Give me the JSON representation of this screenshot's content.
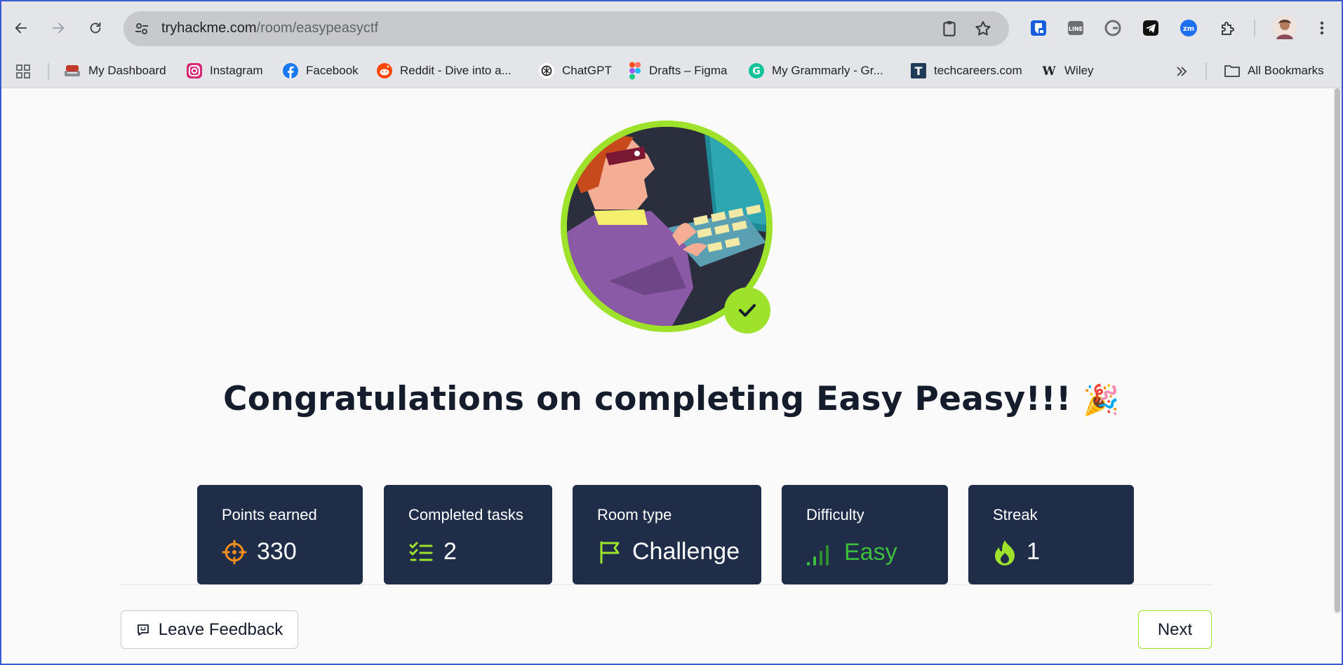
{
  "browser": {
    "url_domain": "tryhackme.com",
    "url_path": "/room/easypeasyctf"
  },
  "extensions": [
    {
      "icon": "bitwarden-icon",
      "color": "#175ddc"
    },
    {
      "icon": "line-icon",
      "color": "#6b6e72"
    },
    {
      "icon": "grammarly-icon",
      "color": "#6b6e72"
    },
    {
      "icon": "telegram-icon",
      "color": "#111111"
    },
    {
      "icon": "zoom-icon",
      "color": "#1e6ff0"
    },
    {
      "icon": "extensions-puzzle-icon",
      "color": "#3c4043"
    }
  ],
  "bookmarks": [
    {
      "label": "My Dashboard",
      "icon": "dashboard-icon",
      "color": "#8a8f96"
    },
    {
      "label": "Instagram",
      "icon": "instagram-icon",
      "color": "#d62976"
    },
    {
      "label": "Facebook",
      "icon": "facebook-icon",
      "color": "#1877f2"
    },
    {
      "label": "Reddit - Dive into a...",
      "icon": "reddit-icon",
      "color": "#ff4500"
    },
    {
      "label": "ChatGPT",
      "icon": "chatgpt-icon",
      "color": "#ffffff"
    },
    {
      "label": "Drafts – Figma",
      "icon": "figma-icon",
      "color": "#a259ff"
    },
    {
      "label": "My Grammarly - Gr...",
      "icon": "grammarly-icon",
      "color": "#15c39a"
    },
    {
      "label": "techcareers.com",
      "icon": "techcareers-icon",
      "color": "#1f3b57"
    },
    {
      "label": "Wiley",
      "icon": "wiley-icon",
      "color": "#ffffff"
    }
  ],
  "bookmarks_all": "All Bookmarks",
  "page": {
    "title": "Congratulations on completing Easy Peasy!!!",
    "title_emoji": "🎉",
    "stats": [
      {
        "label": "Points earned",
        "value": "330",
        "icon": "target-icon",
        "color": "#f5901e"
      },
      {
        "label": "Completed tasks",
        "value": "2",
        "icon": "checklist-icon",
        "color": "#9ee22b"
      },
      {
        "label": "Room type",
        "value": "Challenge",
        "icon": "flag-icon",
        "color": "#9ee22b"
      },
      {
        "label": "Difficulty",
        "value": "Easy",
        "icon": "signal-bars-icon",
        "color": "#3dbd3d"
      },
      {
        "label": "Streak",
        "value": "1",
        "icon": "flame-icon",
        "color": "#9ee22b"
      }
    ],
    "feedback_label": "Leave Feedback",
    "next_label": "Next"
  },
  "colors": {
    "accent": "#9ee22b",
    "card_bg": "#1f2d49",
    "title": "#151c2b"
  }
}
